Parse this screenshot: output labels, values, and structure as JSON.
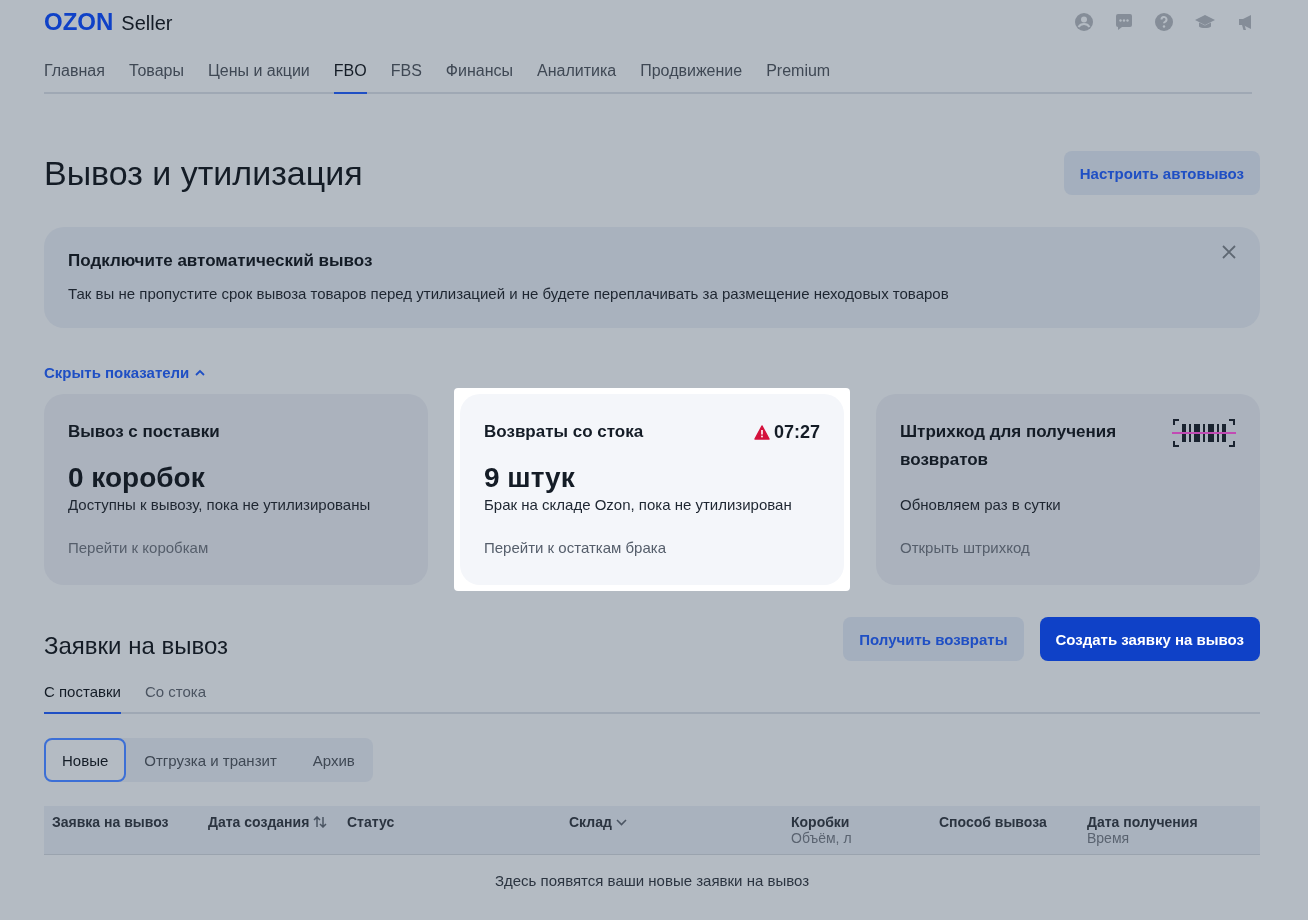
{
  "header": {
    "logo": "OZON",
    "product": "Seller"
  },
  "nav": [
    {
      "label": "Главная",
      "selected": false
    },
    {
      "label": "Товары",
      "selected": false
    },
    {
      "label": "Цены и акции",
      "selected": false
    },
    {
      "label": "FBO",
      "selected": true
    },
    {
      "label": "FBS",
      "selected": false
    },
    {
      "label": "Финансы",
      "selected": false
    },
    {
      "label": "Аналитика",
      "selected": false
    },
    {
      "label": "Продвижение",
      "selected": false
    },
    {
      "label": "Premium",
      "selected": false
    }
  ],
  "page_title": "Вывоз и утилизация",
  "autoremoval_button": "Настроить автовывоз",
  "banner": {
    "title": "Подключите автоматический вывоз",
    "text": "Так вы не пропустите срок вывоза товаров перед утилизацией и не будете переплачивать за размещение неходовых товаров"
  },
  "toggle_metrics": "Скрыть показатели",
  "cards": [
    {
      "kind": "count",
      "highlighted": false,
      "title": "Вывоз с поставки",
      "value": "0 коробок",
      "description": "Доступны к вывозу, пока не утилизированы",
      "link": "Перейти к коробкам"
    },
    {
      "kind": "count",
      "highlighted": true,
      "title": "Возвраты со стока",
      "timer": "07:27",
      "value": "9 штук",
      "description": "Брак на складе Ozon, пока не утилизирован",
      "link": "Перейти к остаткам брака"
    },
    {
      "kind": "barcode",
      "highlighted": false,
      "title": "Штрихкод для получения возвратов",
      "description": "Обновляем раз в сутки",
      "link": "Открыть штрихкод"
    }
  ],
  "requests": {
    "title": "Заявки на вывоз",
    "buttons": [
      {
        "label": "Получить возвраты",
        "kind": "secondary"
      },
      {
        "label": "Создать заявку на вывоз",
        "kind": "primary"
      }
    ],
    "tabs": [
      {
        "label": "С поставки",
        "selected": true
      },
      {
        "label": "Со стока",
        "selected": false
      }
    ],
    "filters": [
      {
        "label": "Новые",
        "selected": true
      },
      {
        "label": "Отгрузка и транзит",
        "selected": false
      },
      {
        "label": "Архив",
        "selected": false
      }
    ],
    "columns": [
      {
        "label": "Заявка на вывоз",
        "kind": "plain"
      },
      {
        "label": "Дата создания",
        "kind": "sort"
      },
      {
        "label": "Статус",
        "kind": "plain"
      },
      {
        "label": "Склад",
        "kind": "dropdown"
      },
      {
        "label": "Коробки",
        "sub": "Объём, л",
        "kind": "plain"
      },
      {
        "label": "Способ вывоза",
        "kind": "plain"
      },
      {
        "label": "Дата получения",
        "sub": "Время",
        "kind": "plain"
      }
    ],
    "empty": "Здесь появятся ваши новые заявки на вывоз"
  }
}
